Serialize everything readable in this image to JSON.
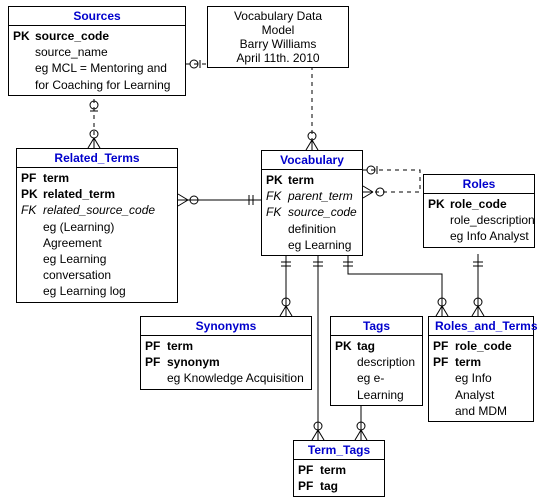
{
  "info": {
    "title": "Vocabulary Data Model",
    "author": "Barry Williams",
    "date": "April 11th. 2010"
  },
  "entities": {
    "sources": {
      "name": "Sources",
      "rows": [
        {
          "k": "PK",
          "v": "source_code",
          "bold": true
        },
        {
          "k": "",
          "v": "source_name"
        },
        {
          "k": "",
          "v": "eg MCL = Mentoring and"
        },
        {
          "k": "",
          "v": "for Coaching for Learning"
        }
      ]
    },
    "related_terms": {
      "name": "Related_Terms",
      "rows": [
        {
          "k": "PF",
          "v": "term",
          "bold": true
        },
        {
          "k": "PK",
          "v": "related_term",
          "bold": true
        },
        {
          "k": "FK",
          "v": "related_source_code",
          "italic": true
        },
        {
          "k": "",
          "v": "eg (Learning) Agreement"
        },
        {
          "k": "",
          "v": "eg Learning conversation"
        },
        {
          "k": "",
          "v": "eg Learning log"
        }
      ]
    },
    "vocabulary": {
      "name": "Vocabulary",
      "rows": [
        {
          "k": "PK",
          "v": "term",
          "bold": true
        },
        {
          "k": "FK",
          "v": "parent_term",
          "italic": true
        },
        {
          "k": "FK",
          "v": "source_code",
          "italic": true
        },
        {
          "k": "",
          "v": "definition"
        },
        {
          "k": "",
          "v": "eg Learning"
        }
      ]
    },
    "roles": {
      "name": "Roles",
      "rows": [
        {
          "k": "PK",
          "v": "role_code",
          "bold": true
        },
        {
          "k": "",
          "v": "role_description"
        },
        {
          "k": "",
          "v": "eg Info Analyst"
        }
      ]
    },
    "synonyms": {
      "name": "Synonyms",
      "rows": [
        {
          "k": "PF",
          "v": "term",
          "bold": true
        },
        {
          "k": "PF",
          "v": "synonym",
          "bold": true
        },
        {
          "k": "",
          "v": "eg Knowledge Acquisition"
        }
      ]
    },
    "tags": {
      "name": "Tags",
      "rows": [
        {
          "k": "PK",
          "v": "tag",
          "bold": true
        },
        {
          "k": "",
          "v": "description"
        },
        {
          "k": "",
          "v": "eg e-Learning"
        }
      ]
    },
    "roles_and_terms": {
      "name": "Roles_and_Terms",
      "rows": [
        {
          "k": "PF",
          "v": "role_code",
          "bold": true
        },
        {
          "k": "PF",
          "v": "term",
          "bold": true
        },
        {
          "k": "",
          "v": "eg Info Analyst"
        },
        {
          "k": "",
          "v": "and MDM"
        }
      ]
    },
    "term_tags": {
      "name": "Term_Tags",
      "rows": [
        {
          "k": "PF",
          "v": "term",
          "bold": true
        },
        {
          "k": "PF",
          "v": "tag",
          "bold": true
        }
      ]
    }
  },
  "chart_data": {
    "type": "diagram",
    "title": "Vocabulary Data Model",
    "author": "Barry Williams",
    "date": "April 11th. 2010",
    "notation": "Entity-Relationship (crow's foot)",
    "entities": [
      {
        "name": "Sources",
        "attributes": [
          {
            "key": "PK",
            "name": "source_code"
          },
          {
            "name": "source_name"
          }
        ],
        "examples": [
          "MCL = Mentoring and for Coaching for Learning"
        ]
      },
      {
        "name": "Related_Terms",
        "attributes": [
          {
            "key": "PF",
            "name": "term"
          },
          {
            "key": "PK",
            "name": "related_term"
          },
          {
            "key": "FK",
            "name": "related_source_code"
          }
        ],
        "examples": [
          "(Learning) Agreement",
          "Learning conversation",
          "Learning log"
        ]
      },
      {
        "name": "Vocabulary",
        "attributes": [
          {
            "key": "PK",
            "name": "term"
          },
          {
            "key": "FK",
            "name": "parent_term"
          },
          {
            "key": "FK",
            "name": "source_code"
          }
        ],
        "other": [
          "definition"
        ],
        "examples": [
          "Learning"
        ]
      },
      {
        "name": "Roles",
        "attributes": [
          {
            "key": "PK",
            "name": "role_code"
          },
          {
            "name": "role_description"
          }
        ],
        "examples": [
          "Info Analyst"
        ]
      },
      {
        "name": "Synonyms",
        "attributes": [
          {
            "key": "PF",
            "name": "term"
          },
          {
            "key": "PF",
            "name": "synonym"
          }
        ],
        "examples": [
          "Knowledge Acquisition"
        ]
      },
      {
        "name": "Tags",
        "attributes": [
          {
            "key": "PK",
            "name": "tag"
          },
          {
            "name": "description"
          }
        ],
        "examples": [
          "e-Learning"
        ]
      },
      {
        "name": "Roles_and_Terms",
        "attributes": [
          {
            "key": "PF",
            "name": "role_code"
          },
          {
            "key": "PF",
            "name": "term"
          }
        ],
        "examples": [
          "Info Analyst and MDM"
        ]
      },
      {
        "name": "Term_Tags",
        "attributes": [
          {
            "key": "PF",
            "name": "term"
          },
          {
            "key": "PF",
            "name": "tag"
          }
        ]
      }
    ],
    "relationships": [
      {
        "from": "Sources",
        "to": "Related_Terms",
        "from_card": "zero-or-one",
        "to_card": "zero-or-many",
        "identifying": false
      },
      {
        "from": "Sources",
        "to": "Vocabulary",
        "from_card": "zero-or-one",
        "to_card": "zero-or-many",
        "identifying": false
      },
      {
        "from": "Vocabulary",
        "to": "Related_Terms",
        "from_card": "one",
        "to_card": "zero-or-many",
        "identifying": true
      },
      {
        "from": "Vocabulary",
        "to": "Vocabulary",
        "from_card": "zero-or-one",
        "to_card": "zero-or-many",
        "identifying": false,
        "self": true,
        "via": "parent_term"
      },
      {
        "from": "Vocabulary",
        "to": "Synonyms",
        "from_card": "one",
        "to_card": "zero-or-many",
        "identifying": true
      },
      {
        "from": "Vocabulary",
        "to": "Term_Tags",
        "from_card": "one",
        "to_card": "zero-or-many",
        "identifying": true
      },
      {
        "from": "Vocabulary",
        "to": "Roles_and_Terms",
        "from_card": "one",
        "to_card": "zero-or-many",
        "identifying": true
      },
      {
        "from": "Tags",
        "to": "Term_Tags",
        "from_card": "one",
        "to_card": "zero-or-many",
        "identifying": true
      },
      {
        "from": "Roles",
        "to": "Roles_and_Terms",
        "from_card": "one",
        "to_card": "zero-or-many",
        "identifying": true
      }
    ]
  }
}
